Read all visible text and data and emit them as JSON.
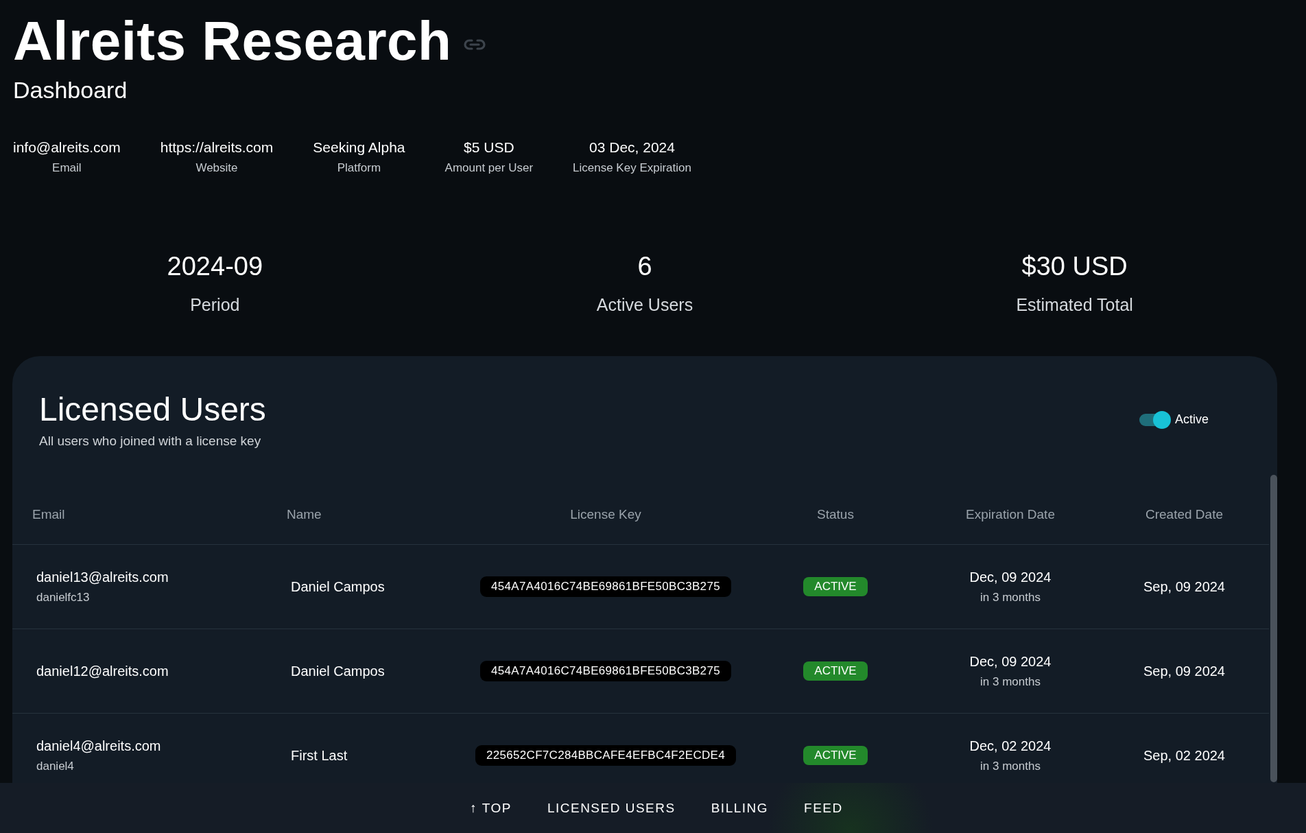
{
  "header": {
    "title": "Alreits Research",
    "subtitle": "Dashboard"
  },
  "info": [
    {
      "value": "info@alreits.com",
      "label": "Email"
    },
    {
      "value": "https://alreits.com",
      "label": "Website"
    },
    {
      "value": "Seeking Alpha",
      "label": "Platform"
    },
    {
      "value": "$5 USD",
      "label": "Amount per User"
    },
    {
      "value": "03 Dec, 2024",
      "label": "License Key Expiration"
    }
  ],
  "stats": [
    {
      "value": "2024-09",
      "label": "Period"
    },
    {
      "value": "6",
      "label": "Active Users"
    },
    {
      "value": "$30 USD",
      "label": "Estimated Total"
    }
  ],
  "licensed_users": {
    "title": "Licensed Users",
    "subtitle": "All users who joined with a license key",
    "toggle": {
      "label": "Active",
      "on": true
    },
    "columns": [
      "Email",
      "Name",
      "License Key",
      "Status",
      "Expiration Date",
      "Created Date"
    ],
    "rows": [
      {
        "email": "daniel13@alreits.com",
        "username": "danielfc13",
        "name": "Daniel Campos",
        "license_key": "454A7A4016C74BE69861BFE50BC3B275",
        "status": "ACTIVE",
        "color": "#23892b",
        "expiration": "Dec, 09 2024",
        "expiration_relative": "in 3 months",
        "created": "Sep, 09 2024"
      },
      {
        "email": "daniel12@alreits.com",
        "name": "Daniel Campos",
        "license_key": "454A7A4016C74BE69861BFE50BC3B275",
        "status": "ACTIVE",
        "color": "#23892b",
        "expiration": "Dec, 09 2024",
        "expiration_relative": "in 3 months",
        "created": "Sep, 09 2024"
      },
      {
        "email": "daniel4@alreits.com",
        "username": "daniel4",
        "name": "First Last",
        "license_key": "225652CF7C284BBCAFE4EFBC4F2ECDE4",
        "status": "ACTIVE",
        "color": "#23892b",
        "expiration": "Dec, 02 2024",
        "expiration_relative": "in 3 months",
        "created": "Sep, 02 2024"
      }
    ]
  },
  "bottom_nav": [
    "↑ TOP",
    "LICENSED USERS",
    "BILLING",
    "FEED"
  ]
}
